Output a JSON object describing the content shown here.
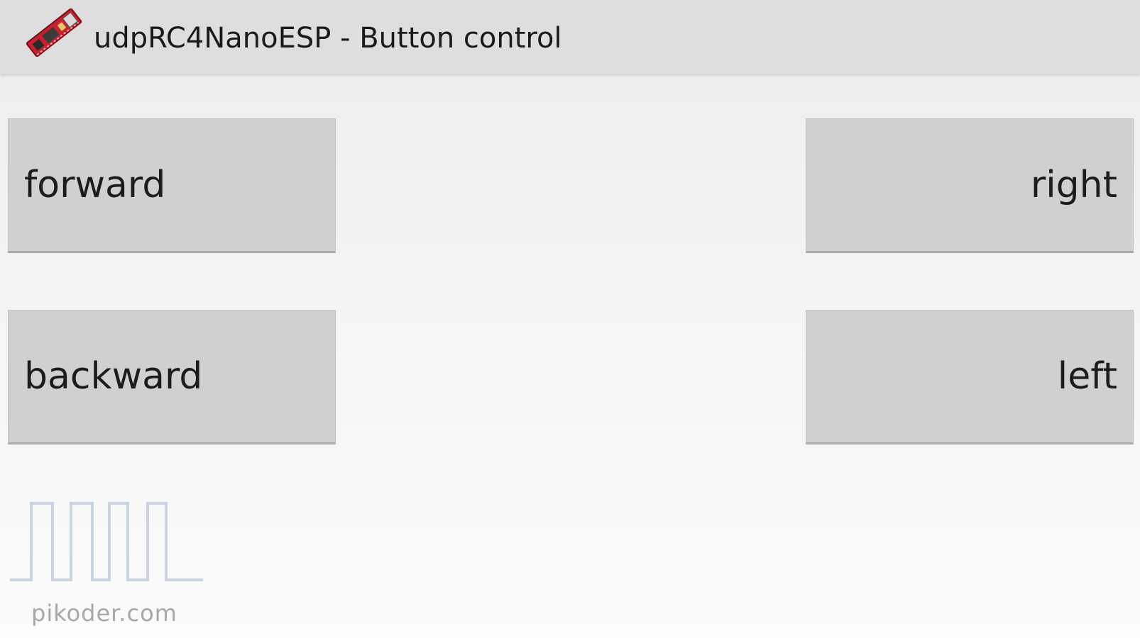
{
  "appbar": {
    "title": "udpRC4NanoESP - Button control",
    "icon": "circuit-board-icon"
  },
  "controls": {
    "forward_label": "forward",
    "right_label": "right",
    "backward_label": "backward",
    "left_label": "left"
  },
  "logo": {
    "text": "pikoder.com",
    "icon": "pulse-waveform-icon"
  },
  "colors": {
    "appbar_bg": "#dedede",
    "button_bg": "#d0d0d0",
    "board_red": "#c8202e",
    "waveform": "#c9d3e2",
    "logo_text": "#a7a7a7"
  }
}
